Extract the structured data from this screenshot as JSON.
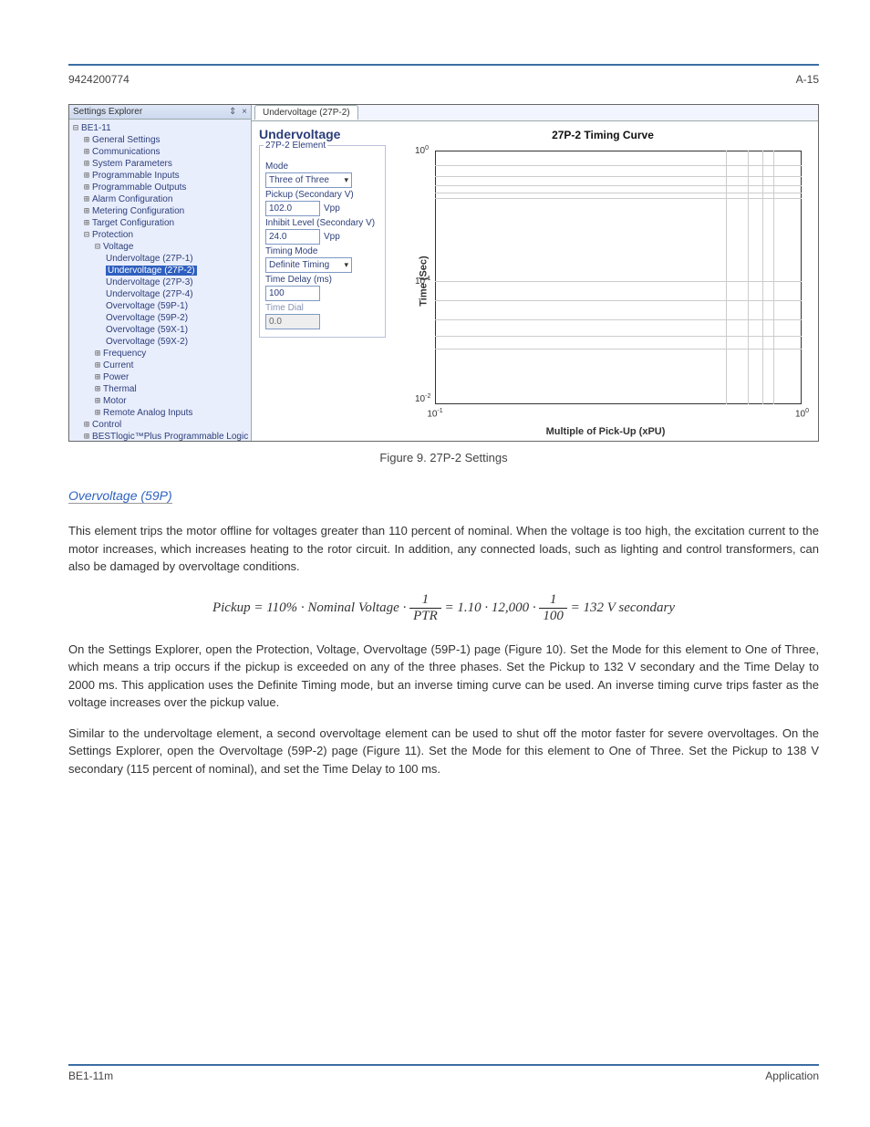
{
  "header": {
    "left": "9424200774",
    "right": "A-15"
  },
  "footer": {
    "left": "BE1-11m",
    "right": "Application"
  },
  "screenshot": {
    "tree_panel_title": "Settings Explorer",
    "pin_icon": "⇕",
    "close_icon": "×",
    "tree_root": "BE1-11",
    "tree_items": [
      "General Settings",
      "Communications",
      "System Parameters",
      "Programmable Inputs",
      "Programmable Outputs",
      "Alarm Configuration",
      "Metering Configuration",
      "Target Configuration"
    ],
    "tree_protection": "Protection",
    "tree_voltage": "Voltage",
    "tree_voltage_items": [
      "Undervoltage (27P-1)",
      "Undervoltage (27P-2)",
      "Undervoltage (27P-3)",
      "Undervoltage (27P-4)",
      "Overvoltage (59P-1)",
      "Overvoltage (59P-2)",
      "Overvoltage (59X-1)",
      "Overvoltage (59X-2)"
    ],
    "tree_voltage_selected_index": 1,
    "tree_after_voltage": [
      "Frequency",
      "Current",
      "Power",
      "Thermal",
      "Motor",
      "Remote Analog Inputs"
    ],
    "tree_control": "Control",
    "tree_bestlogic": "BESTlogic™Plus Programmable Logic",
    "tab_label": "Undervoltage (27P-2)",
    "panel_heading": "Undervoltage",
    "fieldset_legend": "27P-2 Element",
    "mode": {
      "label": "Mode",
      "value": "Three of Three"
    },
    "pickup": {
      "label": "Pickup (Secondary V)",
      "value": "102.0",
      "unit": "Vpp"
    },
    "inhibit": {
      "label": "Inhibit Level (Secondary V)",
      "value": "24.0",
      "unit": "Vpp"
    },
    "timing_mode": {
      "label": "Timing Mode",
      "value": "Definite Timing"
    },
    "time_delay": {
      "label": "Time Delay (ms)",
      "value": "100"
    },
    "time_dial": {
      "label": "Time Dial",
      "value": "0.0"
    }
  },
  "chart_data": {
    "type": "scatter",
    "title": "27P-2 Timing Curve",
    "xlabel": "Multiple of Pick-Up (xPU)",
    "ylabel": "Time (Sec)",
    "x_scale": "log",
    "y_scale": "log",
    "xlim": [
      0.1,
      1
    ],
    "ylim": [
      0.01,
      1
    ],
    "x_ticks": [
      0.1,
      1
    ],
    "x_tick_labels": [
      "10⁻¹",
      "10⁰"
    ],
    "y_ticks": [
      0.01,
      0.1,
      1
    ],
    "y_tick_labels": [
      "10⁻²",
      "10⁻¹",
      "10⁰"
    ],
    "series": []
  },
  "figure_caption": "Figure 9. 27P-2 Settings",
  "section_heading": "Overvoltage (59P)",
  "paragraphs": {
    "p1": "This element trips the motor offline for voltages greater than 110 percent of nominal. When the voltage is too high, the excitation current to the motor increases, which increases heating to the rotor circuit. In addition, any connected loads, such as lighting and control transformers, can also be damaged by overvoltage conditions.",
    "p2": "On the Settings Explorer, open the Protection, Voltage, Overvoltage (59P-1) page (Figure 10). Set the Mode for this element to One of Three, which means a trip occurs if the pickup is exceeded on any of the three phases. Set the Pickup to 132 V secondary and the Time Delay to 2000 ms. This application uses the Definite Timing mode, but an inverse timing curve can be used. An inverse timing curve trips faster as the voltage increases over the pickup value.",
    "p3": "Similar to the undervoltage element, a second overvoltage element can be used to shut off the motor faster for severe overvoltages. On the Settings Explorer, open the Overvoltage (59P-2) page (Figure 11). Set the Mode for this element to One of Three. Set the Pickup to 138 V secondary (115 percent of nominal), and set the Time Delay to 100 ms."
  },
  "equation": {
    "lhs": "Pickup",
    "pct": "110%",
    "nv": "Nominal Voltage",
    "ptr": "PTR",
    "num_factor": "1.10",
    "num_value": "12,000",
    "ptr_val": "100",
    "result": "132 V secondary"
  }
}
